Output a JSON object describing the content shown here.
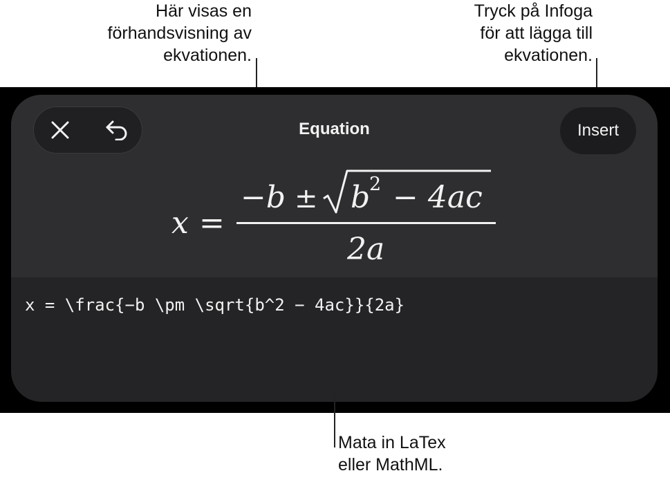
{
  "callouts": {
    "preview": [
      "Här visas en",
      "förhandsvisning av",
      "ekvationen."
    ],
    "insert": [
      "Tryck på Infoga",
      "för att lägga till",
      "ekvationen."
    ],
    "input": [
      "Mata in LaTex",
      "eller MathML."
    ]
  },
  "dialog": {
    "title": "Equation",
    "insert_label": "Insert",
    "close_icon": "close-icon",
    "undo_icon": "undo-icon"
  },
  "preview": {
    "lhs": "x",
    "equals": "=",
    "numerator": {
      "minus_b": "−b",
      "pm": "±",
      "radicand_base": "b",
      "exponent": "2",
      "radicand_rest": "− 4ac"
    },
    "denominator": "2a"
  },
  "input": {
    "value": "x = \\frac{−b \\pm \\sqrt{b^2 − 4ac}}{2a}"
  },
  "colors": {
    "panel": "#242426",
    "preview_area": "#2e2e30",
    "button_bg": "#1c1c1e",
    "text": "#f2f2f2"
  }
}
